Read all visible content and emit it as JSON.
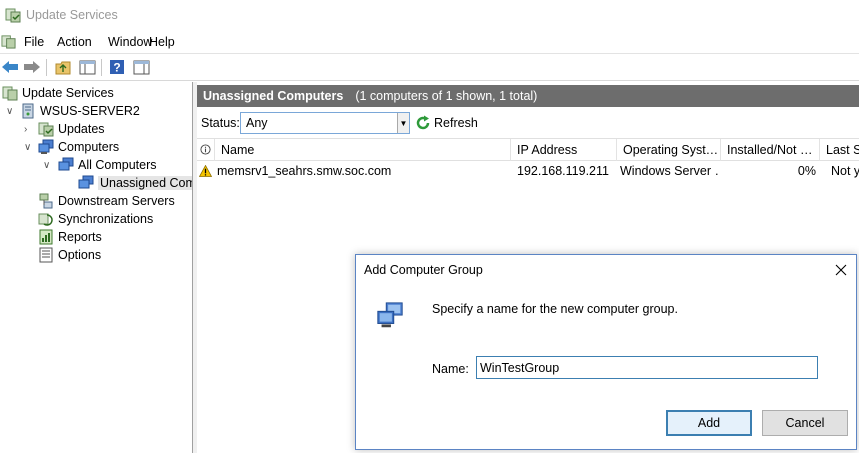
{
  "window": {
    "title": "Update Services"
  },
  "menu": [
    "File",
    "Action",
    "Window",
    "Help"
  ],
  "toolbar": {
    "buttons": [
      "back-icon",
      "forward-icon",
      "up-folder-icon",
      "show-hide-tree-icon",
      "help-icon",
      "properties-pane-icon"
    ]
  },
  "tree": {
    "root": "Update Services",
    "server": "WSUS-SERVER2",
    "updates": "Updates",
    "computers": "Computers",
    "all_computers": "All Computers",
    "unassigned": "Unassigned Computers",
    "downstream": "Downstream Servers",
    "sync": "Synchronizations",
    "reports": "Reports",
    "options": "Options"
  },
  "content": {
    "title": "Unassigned Computers",
    "subtitle": "(1 computers of 1 shown, 1 total)",
    "status_label": "Status:",
    "status_value": "Any",
    "refresh_label": "Refresh",
    "columns": [
      "Name",
      "IP Address",
      "Operating Syst…",
      "Installed/Not …",
      "Last St"
    ],
    "rows": [
      {
        "name": "memsrv1_seahrs.smw.soc.com",
        "ip": "192.168.119.211",
        "os": "Windows Server …",
        "installed": "0%",
        "last": "Not y"
      }
    ]
  },
  "dialog": {
    "title": "Add Computer Group",
    "prompt": "Specify a name for the new computer group.",
    "name_label": "Name:",
    "name_value": "WinTestGroup",
    "add_label": "Add",
    "cancel_label": "Cancel"
  },
  "colors": {
    "header_bg": "#6d6d6d",
    "accent": "#3c7fb1",
    "warning": "#f5c400"
  }
}
